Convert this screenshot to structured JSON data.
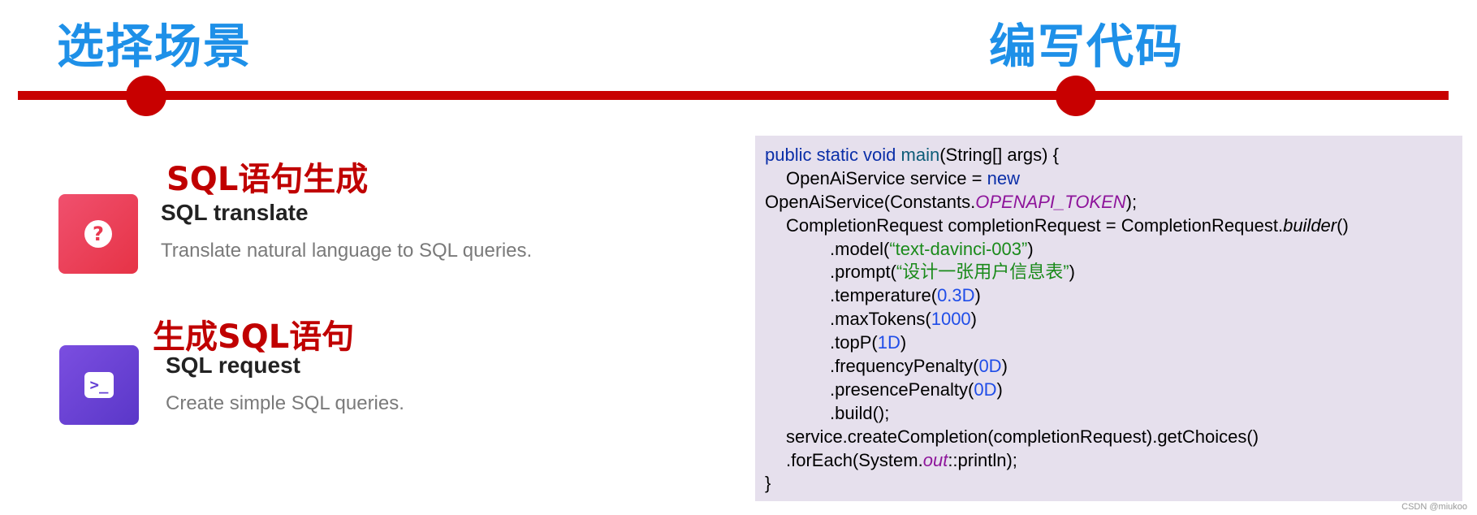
{
  "steps": [
    {
      "title": "选择场景"
    },
    {
      "title": "编写代码"
    }
  ],
  "cards": [
    {
      "label": "SQL语句生成",
      "icon_glyph": "?",
      "icon": "question-icon",
      "icon_color": "#e9394f",
      "title": "SQL translate",
      "description": "Translate natural language to SQL queries."
    },
    {
      "label": "生成SQL语句",
      "icon_glyph": ">_",
      "icon": "terminal-icon",
      "icon_color": "#6440d4",
      "title": "SQL request",
      "description": "Create simple SQL queries."
    }
  ],
  "code": {
    "l1": {
      "a": "public static void ",
      "b": "main",
      "c": "(String[] args) {"
    },
    "l2": {
      "a": "OpenAiService service = ",
      "b": "new"
    },
    "l3": {
      "a": "OpenAiService(Constants.",
      "b": "OPENAPI_TOKEN",
      "c": ");"
    },
    "l4": {
      "a": "CompletionRequest completionRequest = CompletionRequest.",
      "b": "builder",
      "c": "()"
    },
    "l5": {
      "a": ".model(",
      "b": "“text-davinci-003”",
      "c": ")"
    },
    "l6": {
      "a": ".prompt(",
      "b": "“设计一张用户信息表”",
      "c": ")"
    },
    "l7": {
      "a": ".temperature(",
      "b": "0.3D",
      "c": ")"
    },
    "l8": {
      "a": ".maxTokens(",
      "b": "1000",
      "c": ")"
    },
    "l9": {
      "a": ".topP(",
      "b": "1D",
      "c": ")"
    },
    "l10": {
      "a": ".frequencyPenalty(",
      "b": "0D",
      "c": ")"
    },
    "l11": {
      "a": ".presencePenalty(",
      "b": "0D",
      "c": ")"
    },
    "l12": {
      "a": ".build();"
    },
    "l13": {
      "a": "service.createCompletion(completionRequest).getChoices()"
    },
    "l14": {
      "a": ".forEach(System.",
      "b": "out",
      "c": "::println);"
    },
    "l15": {
      "a": "}"
    }
  },
  "watermark": "CSDN @miukoo",
  "colors": {
    "title_blue": "#1e90e8",
    "timeline_red": "#c80000",
    "label_red": "#c00000",
    "code_bg": "#e6e0ed"
  }
}
